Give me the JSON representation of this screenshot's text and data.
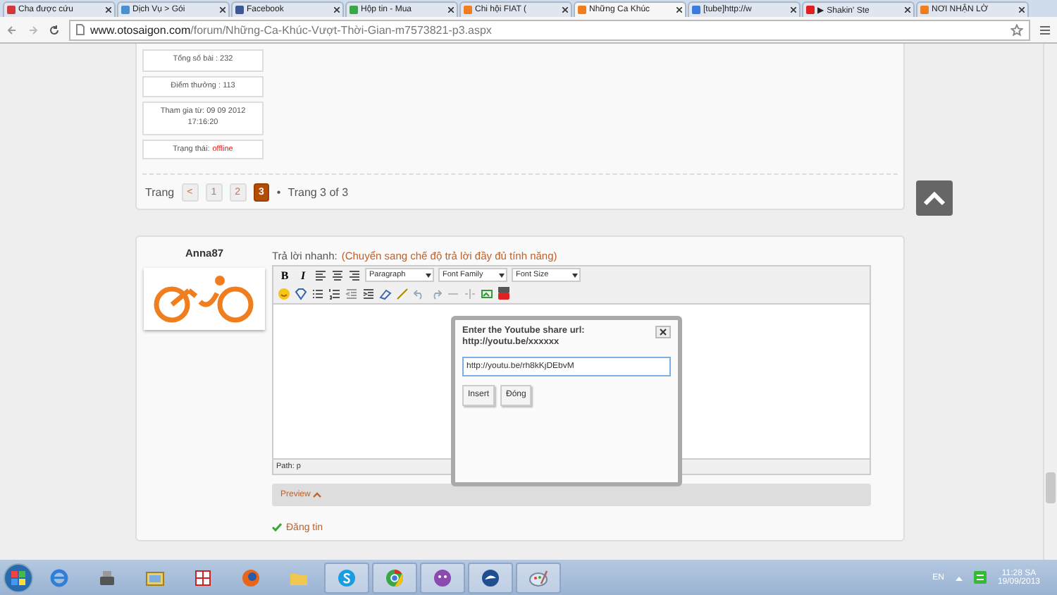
{
  "browser": {
    "tabs": [
      {
        "title": "Cha được cứu",
        "selected": false,
        "color": "#d23a3a"
      },
      {
        "title": "Dịch Vụ > Gói",
        "selected": false,
        "color": "#4a8fd0"
      },
      {
        "title": "Facebook",
        "selected": false,
        "color": "#3b5998"
      },
      {
        "title": "Hộp tin - Mua",
        "selected": false,
        "color": "#3aa648"
      },
      {
        "title": "Chi hội FIAT (",
        "selected": false,
        "color": "#f07d1e"
      },
      {
        "title": "Những Ca Khúc",
        "selected": true,
        "color": "#f07d1e"
      },
      {
        "title": "[tube]http://w",
        "selected": false,
        "color": "#3a7be0"
      },
      {
        "title": "▶ Shakin' Ste",
        "selected": false,
        "color": "#e02020"
      },
      {
        "title": "NƠI NHẬN LỜ",
        "selected": false,
        "color": "#f07d1e"
      }
    ],
    "url_host": "www.otosaigon.com",
    "url_path": "/forum/Những-Ca-Khúc-Vượt-Thời-Gian-m7573821-p3.aspx"
  },
  "user_stats": [
    "Tổng số bài : 232",
    "Điểm thưởng : 113",
    "Tham gia từ: 09 09 2012 17:16:20"
  ],
  "user_status": {
    "label": "Trạng thái:",
    "value": "offline"
  },
  "pagination": {
    "label": "Trang",
    "prev": "<",
    "pages": [
      {
        "label": "1",
        "selected": false
      },
      {
        "label": "2",
        "selected": false
      },
      {
        "label": "3",
        "selected": true
      }
    ],
    "separator": "•",
    "summary": "Trang 3 of 3"
  },
  "reply": {
    "author": "Anna87",
    "title": "Trả lời nhanh:",
    "mode_link": "(Chuyển sang chế độ trả lời đầy đủ tính năng)",
    "bold": "B",
    "italic": "I",
    "selects": [
      "Paragraph",
      "Font Family",
      "Font Size"
    ],
    "path": "Path: p",
    "preview": "Preview",
    "submit": "Đăng tin"
  },
  "dialog": {
    "title": "Enter the Youtube share url: http://youtu.be/xxxxxx",
    "value": "http://youtu.be/rh8kKjDEbvM",
    "buttons": [
      "Insert",
      "Đóng"
    ]
  },
  "taskbar": {
    "apps": [
      {
        "kind": "ie",
        "running": false
      },
      {
        "kind": "scanner",
        "running": false
      },
      {
        "kind": "photo",
        "running": false
      },
      {
        "kind": "grid",
        "running": false
      },
      {
        "kind": "firefox",
        "running": false
      },
      {
        "kind": "folder",
        "running": false
      },
      {
        "kind": "skype",
        "running": true
      },
      {
        "kind": "chrome",
        "running": true
      },
      {
        "kind": "messenger",
        "running": true
      },
      {
        "kind": "bird",
        "running": true
      },
      {
        "kind": "paint",
        "running": true
      }
    ],
    "language": "EN",
    "time": "11:28 SA",
    "date": "19/09/2013"
  }
}
